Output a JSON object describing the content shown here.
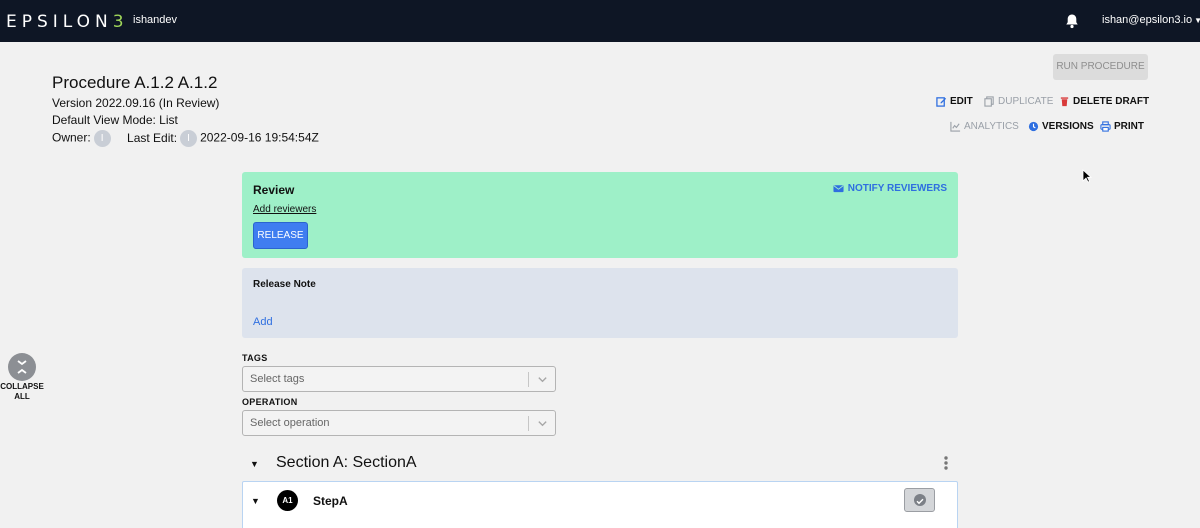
{
  "nav": {
    "logo_main": "EPSILON",
    "logo_accent": "3",
    "workspace": "ishandev",
    "user_email": "ishan@epsilon3.io",
    "bell_icon": "bell-icon"
  },
  "procedure": {
    "title": "Procedure A.1.2 A.1.2",
    "version": "Version 2022.09.16 (In Review)",
    "view_mode": "Default View Mode: List",
    "owner_label": "Owner:",
    "owner_initial": "I",
    "last_edit_label": "Last Edit:",
    "last_edit_initial": "I",
    "last_edit_time": "2022-09-16 19:54:54Z"
  },
  "actions": {
    "run": "RUN PROCEDURE",
    "edit": "EDIT",
    "duplicate": "DUPLICATE",
    "delete_draft": "DELETE DRAFT",
    "analytics": "ANALYTICS",
    "versions": "VERSIONS",
    "print": "PRINT"
  },
  "review": {
    "title": "Review",
    "notify": "NOTIFY REVIEWERS",
    "add_reviewers": "Add reviewers",
    "release": "RELEASE"
  },
  "release_note": {
    "title": "Release Note",
    "add": "Add"
  },
  "tags": {
    "label": "TAGS",
    "placeholder": "Select tags"
  },
  "operation": {
    "label": "OPERATION",
    "placeholder": "Select operation"
  },
  "collapse": {
    "label_line1": "COLLAPSE",
    "label_line2": "ALL"
  },
  "section": {
    "title": "Section A: SectionA",
    "step": {
      "badge": "A1",
      "name": "StepA"
    }
  },
  "colors": {
    "nav_bg": "#0e1625",
    "accent_green": "#9fd65a",
    "review_bg": "#9ef0c8",
    "release_note_bg": "#dde3ed",
    "primary_blue": "#3f7df0",
    "link_blue": "#2f6fe0",
    "delete_red": "#d93a3a"
  }
}
